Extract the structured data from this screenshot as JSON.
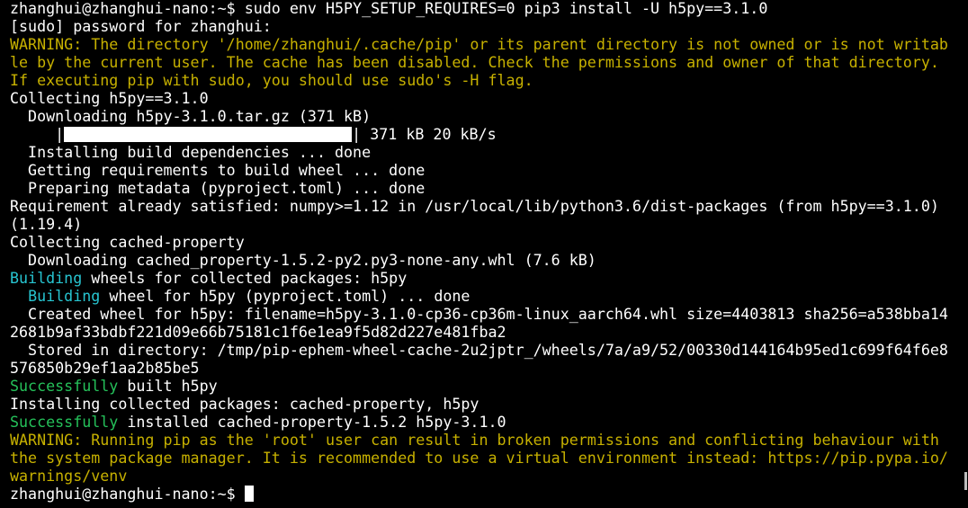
{
  "terminal": {
    "lines": [
      "zhanghui@zhanghui-nano:~$ sudo env H5PY_SETUP_REQUIRES=0 pip3 install -U h5py==3.1.0",
      "[sudo] password for zhanghui:",
      "WARNING: The directory '/home/zhanghui/.cache/pip' or its parent directory is not owned or is not writab",
      "le by the current user. The cache has been disabled. Check the permissions and owner of that directory.",
      "If executing pip with sudo, you should use sudo's -H flag.",
      "Collecting h5py==3.1.0",
      "  Downloading h5py-3.1.0.tar.gz (371 kB)",
      "     |",
      "| 371 kB 20 kB/s",
      "  Installing build dependencies ... done",
      "  Getting requirements to build wheel ... done",
      "  Preparing metadata (pyproject.toml) ... done",
      "Requirement already satisfied: numpy>=1.12 in /usr/local/lib/python3.6/dist-packages (from h5py==3.1.0)",
      "(1.19.4)",
      "Collecting cached-property",
      "  Downloading cached_property-1.5.2-py2.py3-none-any.whl (7.6 kB)",
      "Building",
      " wheels for collected packages: h5py",
      "  ",
      "Building",
      " wheel for h5py (pyproject.toml) ... done",
      "  Created wheel for h5py: filename=h5py-3.1.0-cp36-cp36m-linux_aarch64.whl size=4403813 sha256=a538bba14",
      "2681b9af33bdbf221d09e66b75181c1f6e1ea9f5d82d227e481fba2",
      "  Stored in directory: /tmp/pip-ephem-wheel-cache-2u2jptr_/wheels/7a/a9/52/00330d144164b95ed1c699f64f6e8",
      "576850b29ef1aa2b85be5",
      "Successfully",
      " built h5py",
      "Installing collected packages: cached-property, h5py",
      "Successfully",
      " installed cached-property-1.5.2 h5py-3.1.0",
      "WARNING: Running pip as the 'root' user can result in broken permissions and conflicting behaviour with",
      "the system package manager. It is recommended to use a virtual environment instead: https://pip.pypa.io/",
      "warnings/venv",
      "zhanghui@zhanghui-nano:~$ "
    ],
    "download_progress": 1.0
  },
  "colors": {
    "background": "#000000",
    "text": "#ffffff",
    "warning": "#c7b100",
    "info": "#27c5d1",
    "success": "#25c15a"
  }
}
